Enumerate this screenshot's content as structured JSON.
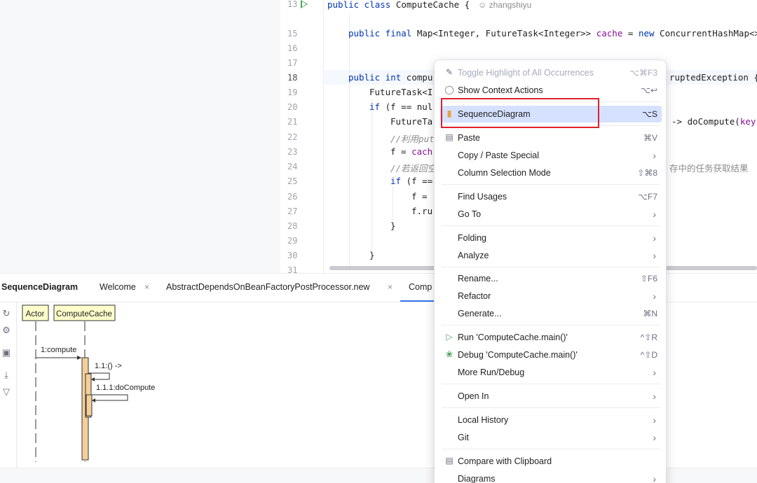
{
  "editor": {
    "line_numbers": [
      "13",
      "15",
      "16",
      "17",
      "18",
      "19",
      "20",
      "21",
      "22",
      "23",
      "24",
      "25",
      "26",
      "27",
      "28",
      "29",
      "30",
      "31"
    ],
    "author": "zhangshiyu",
    "lines": {
      "l13": {
        "kw": "public class",
        "rest": " ComputeCache {"
      },
      "l15a": "public final",
      "l15b": " Map<Integer, FutureTask<Integer>> ",
      "l15c": "cache",
      "l15d": " = ",
      "l15e": "new",
      "l15f": " ConcurrentHashMap<>",
      "l18a": "public int",
      "l18b": " compu",
      "l18c": "ruptedException {",
      "l19": "FutureTask<I",
      "l20a": "if",
      "l20b": " (f == nul",
      "l21a": "FutureTa",
      "l21b": "-> doCompute(",
      "l21c": "key",
      "l21d": ")",
      "l22": "//利用put",
      "l23a": "f = ",
      "l23b": "cach",
      "l24a": "//若返回空",
      "l24b": "存中的任务获取结果",
      "l25a": "if",
      "l25b": " (f ==",
      "l26": "f = ",
      "l27": "f.ru",
      "l28": "}",
      "l30": "}"
    }
  },
  "tool_window": {
    "tabs": [
      "SequenceDiagram",
      "Welcome",
      "AbstractDependsOnBeanFactoryPostProcessor.new",
      "Comp"
    ],
    "close_glyph": "×",
    "toolstrip_icons": [
      "refresh-icon",
      "settings-icon",
      "save-icon",
      "download-icon",
      "filter-icon"
    ],
    "diagram": {
      "lifelines": [
        "Actor",
        "ComputeCache"
      ],
      "messages": [
        "1:compute",
        "1.1:() ->",
        "1.1.1:doCompute"
      ]
    }
  },
  "context_menu": {
    "items": [
      {
        "label": "Toggle Highlight of All Occurrences",
        "shortcut": "⌥⌘F3",
        "icon": "highlight-icon",
        "disabled": true
      },
      {
        "label": "Show Context Actions",
        "shortcut": "⌥↩",
        "icon": "bulb-icon"
      },
      {
        "label": "SequenceDiagram",
        "shortcut": "⌥S",
        "icon": "sequence-diagram-icon",
        "selected": true
      },
      {
        "label": "Paste",
        "shortcut": "⌘V",
        "icon": "clipboard-icon"
      },
      {
        "label": "Copy / Paste Special",
        "submenu": true
      },
      {
        "label": "Column Selection Mode",
        "shortcut": "⇧⌘8"
      },
      {
        "label": "Find Usages",
        "shortcut": "⌥F7"
      },
      {
        "label": "Go To",
        "submenu": true
      },
      {
        "label": "Folding",
        "submenu": true
      },
      {
        "label": "Analyze",
        "submenu": true
      },
      {
        "label": "Rename...",
        "shortcut": "⇧F6"
      },
      {
        "label": "Refactor",
        "submenu": true
      },
      {
        "label": "Generate...",
        "shortcut": "⌘N"
      },
      {
        "label": "Run 'ComputeCache.main()'",
        "shortcut": "^⇧R",
        "icon": "run-icon"
      },
      {
        "label": "Debug 'ComputeCache.main()'",
        "shortcut": "^⇧D",
        "icon": "debug-icon"
      },
      {
        "label": "More Run/Debug",
        "submenu": true
      },
      {
        "label": "Open In",
        "submenu": true
      },
      {
        "label": "Local History",
        "submenu": true
      },
      {
        "label": "Git",
        "submenu": true
      },
      {
        "label": "Compare with Clipboard",
        "icon": "compare-icon"
      },
      {
        "label": "Diagrams",
        "submenu": true
      }
    ],
    "chevron": "›"
  },
  "colors": {
    "selection": "#d5e1ff",
    "highlight_box": "#e0202a",
    "keyword": "#0033b3",
    "field": "#871094",
    "lifeline_fill": "#ffffcc",
    "activation_fill": "#f5cf99"
  }
}
